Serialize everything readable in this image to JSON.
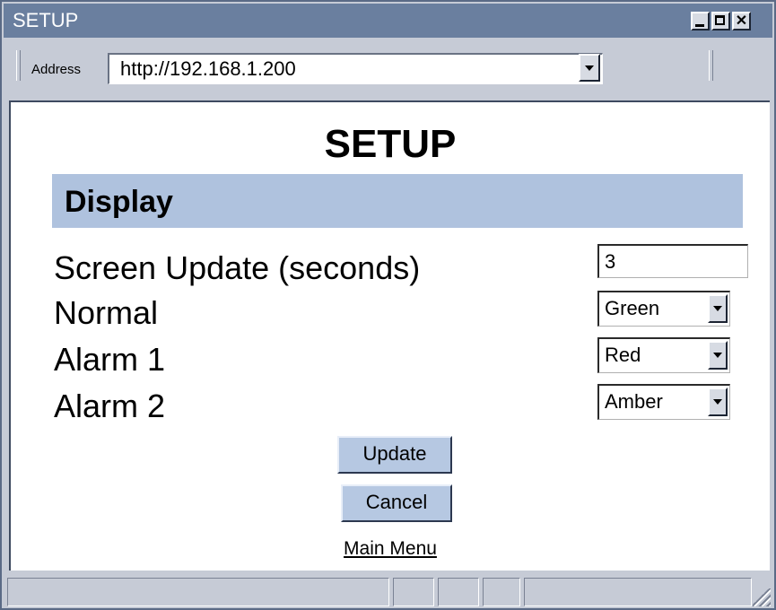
{
  "window": {
    "title": "SETUP"
  },
  "address_bar": {
    "label": "Address",
    "url": "http://192.168.1.200"
  },
  "page": {
    "title": "SETUP",
    "section": "Display",
    "fields": {
      "screen_update": {
        "label": "Screen Update (seconds)",
        "value": "3"
      },
      "normal": {
        "label": "Normal",
        "value": "Green"
      },
      "alarm1": {
        "label": "Alarm 1",
        "value": "Red"
      },
      "alarm2": {
        "label": "Alarm 2",
        "value": "Amber"
      }
    },
    "buttons": {
      "update": "Update",
      "cancel": "Cancel"
    },
    "link": "Main Menu"
  },
  "colors": {
    "titlebar": "#6a7f9f",
    "section_bar": "#afc2de",
    "button": "#b6c8e2"
  },
  "icons": [
    "minimize-icon",
    "maximize-icon",
    "close-icon",
    "dropdown-arrow-icon",
    "resize-grip-icon"
  ]
}
